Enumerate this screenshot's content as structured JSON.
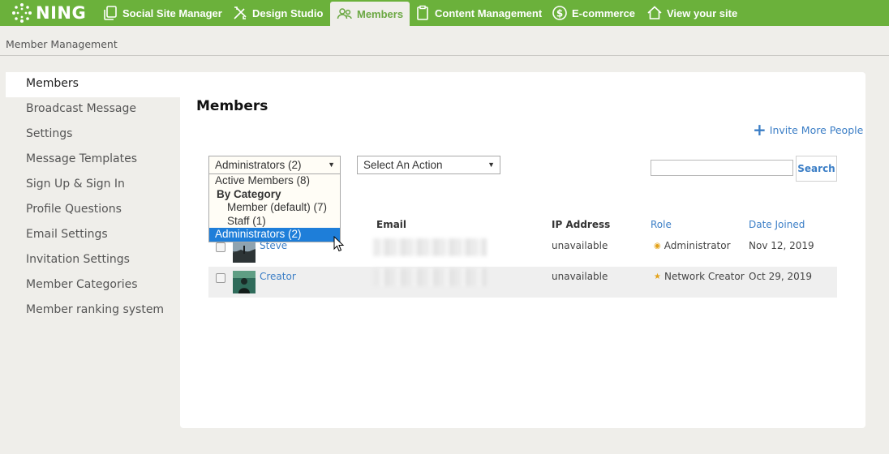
{
  "brand": {
    "name": "NING",
    "accent": "#6bb13b"
  },
  "nav": [
    {
      "label": "Social Site Manager",
      "icon": "copy-icon"
    },
    {
      "label": "Design Studio",
      "icon": "tools-icon"
    },
    {
      "label": "Members",
      "icon": "people-icon",
      "active": true
    },
    {
      "label": "Content Management",
      "icon": "clipboard-icon"
    },
    {
      "label": "E-commerce",
      "icon": "dollar-icon"
    },
    {
      "label": "View your site",
      "icon": "home-icon"
    }
  ],
  "breadcrumb": "Member Management",
  "sidebar": {
    "items": [
      {
        "label": "Members",
        "active": true
      },
      {
        "label": "Broadcast Message"
      },
      {
        "label": "Settings"
      },
      {
        "label": "Message Templates"
      },
      {
        "label": "Sign Up & Sign In"
      },
      {
        "label": "Profile Questions"
      },
      {
        "label": "Email Settings"
      },
      {
        "label": "Invitation Settings"
      },
      {
        "label": "Member Categories"
      },
      {
        "label": "Member ranking system"
      }
    ]
  },
  "main": {
    "title": "Members",
    "invite_label": "Invite More People",
    "filter_select": {
      "value": "Administrators (2)",
      "options": [
        {
          "label": "Active Members (8)",
          "kind": "option"
        },
        {
          "label": "By Category",
          "kind": "group"
        },
        {
          "label": "Member (default) (7)",
          "kind": "sub"
        },
        {
          "label": "Staff (1)",
          "kind": "sub"
        },
        {
          "label": "Administrators (2)",
          "kind": "option",
          "selected": true
        }
      ]
    },
    "action_select": {
      "value": "Select An Action"
    },
    "search": {
      "placeholder": "",
      "button_label": "Search"
    },
    "table": {
      "headers": {
        "email": "Email",
        "ip": "IP Address",
        "role": "Role",
        "joined": "Date Joined"
      },
      "rows": [
        {
          "name": "Steve",
          "ip": "unavailable",
          "role": "Administrator",
          "role_mark": "dot",
          "joined": "Nov 12, 2019"
        },
        {
          "name": "Creator",
          "ip": "unavailable",
          "role": "Network Creator",
          "role_mark": "star",
          "joined": "Oct 29, 2019"
        }
      ]
    }
  }
}
